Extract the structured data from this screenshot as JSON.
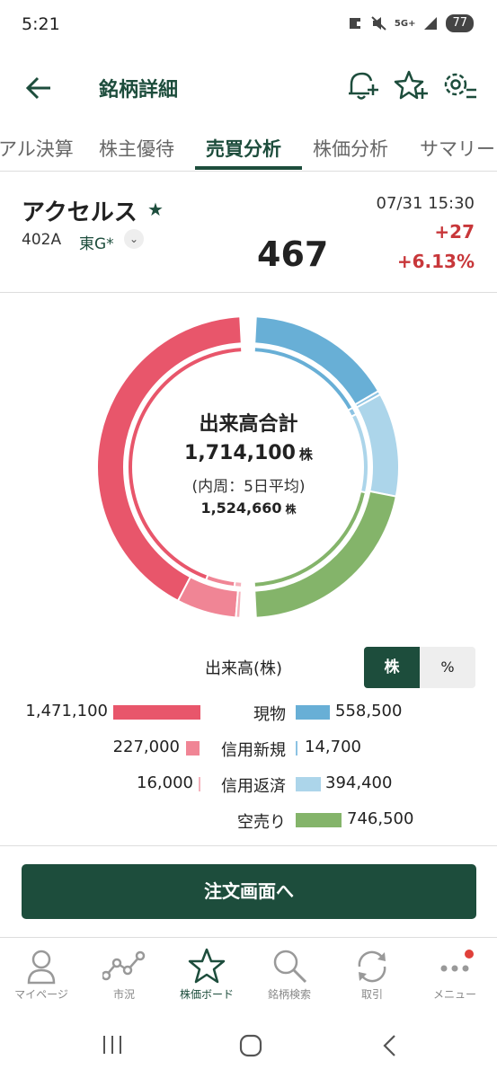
{
  "status": {
    "time": "5:21",
    "network": "5G+",
    "battery": "77"
  },
  "appbar": {
    "title": "銘柄詳細"
  },
  "tabs": [
    "アル決算",
    "株主優待",
    "売買分析",
    "株価分析",
    "サマリー"
  ],
  "active_tab": 2,
  "stock": {
    "name": "アクセルス",
    "code": "402A",
    "market": "東G*",
    "price": "467",
    "datetime": "07/31 15:30",
    "change": "+27",
    "change_pct": "+6.13%"
  },
  "donut": {
    "title": "出来高合計",
    "total": "1,714,100",
    "unit": "株",
    "inner_label": "(内周：5日平均)",
    "inner_total": "1,524,660"
  },
  "legend": {
    "header": "出来高(株)",
    "toggle_on": "株",
    "toggle_off": "%",
    "rows": [
      {
        "left_value": "1,471,100",
        "label": "現物",
        "right_value": "558,500"
      },
      {
        "left_value": "227,000",
        "label": "信用新規",
        "right_value": "14,700"
      },
      {
        "left_value": "16,000",
        "label": "信用返済",
        "right_value": "394,400"
      },
      {
        "left_value": "",
        "label": "空売り",
        "right_value": "746,500"
      }
    ]
  },
  "chart_data": {
    "type": "pie",
    "title": "出来高合計",
    "unit": "株",
    "series": [
      {
        "name": "buy",
        "categories": [
          "現物",
          "信用新規",
          "信用返済"
        ],
        "values": [
          1471100,
          227000,
          16000
        ]
      },
      {
        "name": "sell",
        "categories": [
          "現物",
          "信用新規",
          "信用返済",
          "空売り"
        ],
        "values": [
          558500,
          14700,
          394400,
          746500
        ]
      }
    ],
    "colors": {
      "buy_cash": "#e8566b",
      "buy_margin_new": "#f08595",
      "buy_margin_close": "#f5b2bc",
      "sell_cash": "#68afd6",
      "sell_margin_new": "#8cc3e3",
      "sell_margin_close": "#acd5ea",
      "short_sell": "#84b46a"
    }
  },
  "order_button": "注文画面へ",
  "bottom_nav": [
    "マイページ",
    "市況",
    "株価ボード",
    "銘柄検索",
    "取引",
    "メニュー"
  ],
  "bottom_nav_icons": [
    "person-icon",
    "chart-line-icon",
    "star-icon",
    "search-icon",
    "refresh-icon",
    "more-icon"
  ],
  "accent": "#1d4d3c"
}
